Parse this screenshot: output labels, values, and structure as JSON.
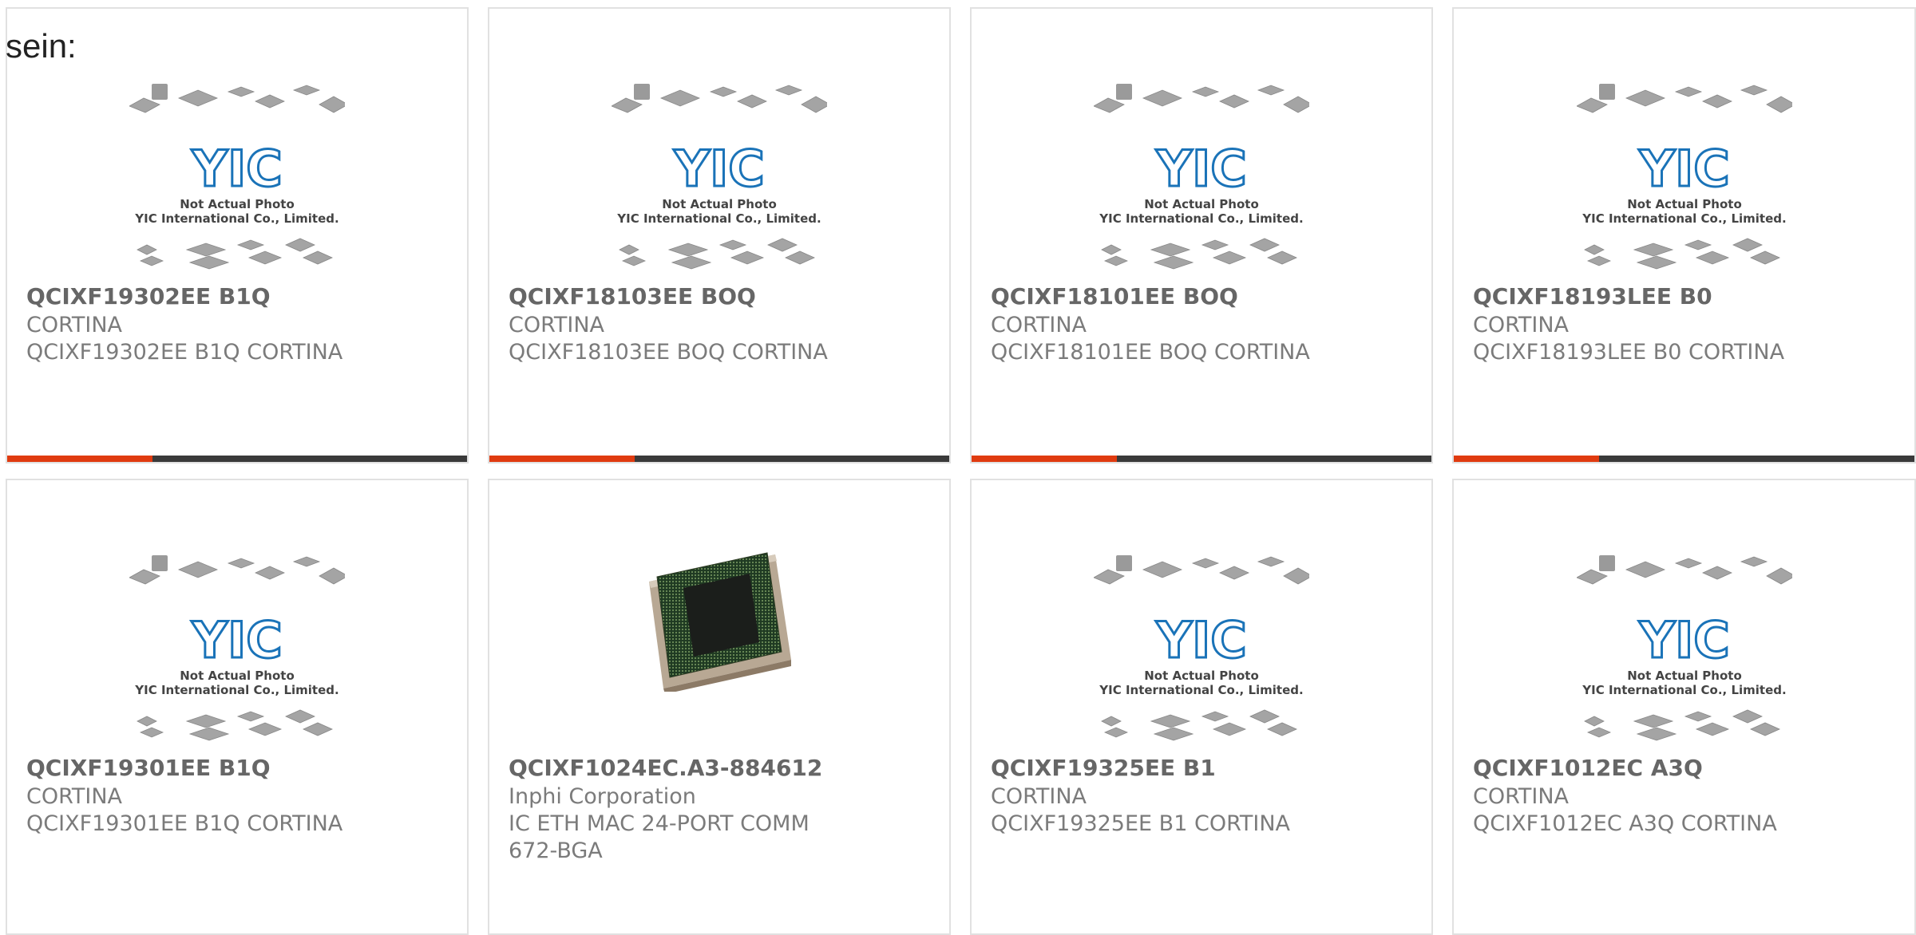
{
  "intro_text": "sein:",
  "placeholder_image": {
    "caption_line1": "Not Actual Photo",
    "caption_line2": "YIC International Co., Limited.",
    "logo_text": "YIC",
    "logo_color": "#1a73b8",
    "caption_color": "#444444"
  },
  "accent_color": "#e03b10",
  "products": [
    {
      "part_number": "QCIXF19302EE B1Q",
      "manufacturer": "CORTINA",
      "description": "QCIXF19302EE B1Q CORTINA",
      "image": "placeholder"
    },
    {
      "part_number": "QCIXF18103EE BOQ",
      "manufacturer": "CORTINA",
      "description": "QCIXF18103EE BOQ CORTINA",
      "image": "placeholder"
    },
    {
      "part_number": "QCIXF18101EE BOQ",
      "manufacturer": "CORTINA",
      "description": "QCIXF18101EE BOQ CORTINA",
      "image": "placeholder"
    },
    {
      "part_number": "QCIXF18193LEE B0",
      "manufacturer": "CORTINA",
      "description": "QCIXF18193LEE B0 CORTINA",
      "image": "placeholder"
    },
    {
      "part_number": "QCIXF19301EE B1Q",
      "manufacturer": "CORTINA",
      "description": "QCIXF19301EE B1Q CORTINA",
      "image": "placeholder"
    },
    {
      "part_number": "QCIXF1024EC.A3-884612",
      "manufacturer": "Inphi Corporation",
      "description": "IC ETH MAC 24-PORT COMM 672-BGA",
      "image": "bga-chip-photo"
    },
    {
      "part_number": "QCIXF19325EE B1",
      "manufacturer": "CORTINA",
      "description": "QCIXF19325EE B1 CORTINA",
      "image": "placeholder"
    },
    {
      "part_number": "QCIXF1012EC A3Q",
      "manufacturer": "CORTINA",
      "description": "QCIXF1012EC A3Q CORTINA",
      "image": "placeholder"
    }
  ]
}
